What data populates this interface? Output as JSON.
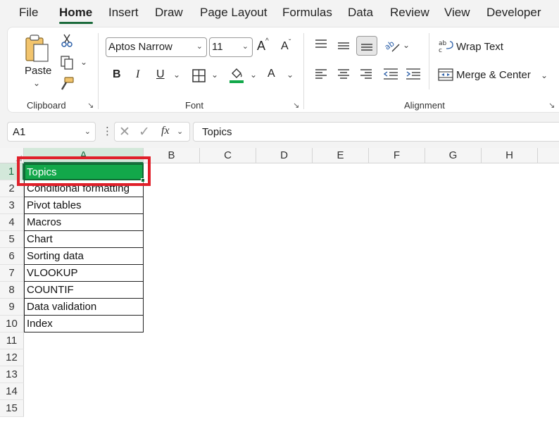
{
  "menu": {
    "tabs": [
      "File",
      "Home",
      "Insert",
      "Draw",
      "Page Layout",
      "Formulas",
      "Data",
      "Review",
      "View",
      "Developer"
    ],
    "active": "Home"
  },
  "ribbon": {
    "clipboard": {
      "paste_label": "Paste",
      "group_label": "Clipboard"
    },
    "font": {
      "font_name": "Aptos Narrow",
      "font_size": "11",
      "grow_label": "A",
      "shrink_label": "A",
      "bold_label": "B",
      "italic_label": "I",
      "underline_label": "U",
      "font_color_label": "A",
      "fill_color": "#12a84a",
      "group_label": "Font"
    },
    "alignment": {
      "wrap_text_label": "Wrap Text",
      "merge_center_label": "Merge & Center",
      "group_label": "Alignment"
    }
  },
  "formula_bar": {
    "name_box": "A1",
    "fx_label": "fx",
    "content": "Topics"
  },
  "grid": {
    "columns": [
      "A",
      "B",
      "C",
      "D",
      "E",
      "F",
      "G",
      "H"
    ],
    "rows": [
      "1",
      "2",
      "3",
      "4",
      "5",
      "6",
      "7",
      "8",
      "9",
      "10",
      "11",
      "12",
      "13",
      "14",
      "15"
    ],
    "cells": [
      "Topics",
      "Conditional formatting",
      "Pivot tables",
      "Macros",
      "Chart",
      "Sorting data",
      "VLOOKUP",
      "COUNTIF",
      "Data validation",
      "Index"
    ],
    "active_cell": "A1",
    "colors": {
      "selection": "#12a84a",
      "highlight": "#e0202a",
      "accent": "#1c6b3c"
    }
  }
}
